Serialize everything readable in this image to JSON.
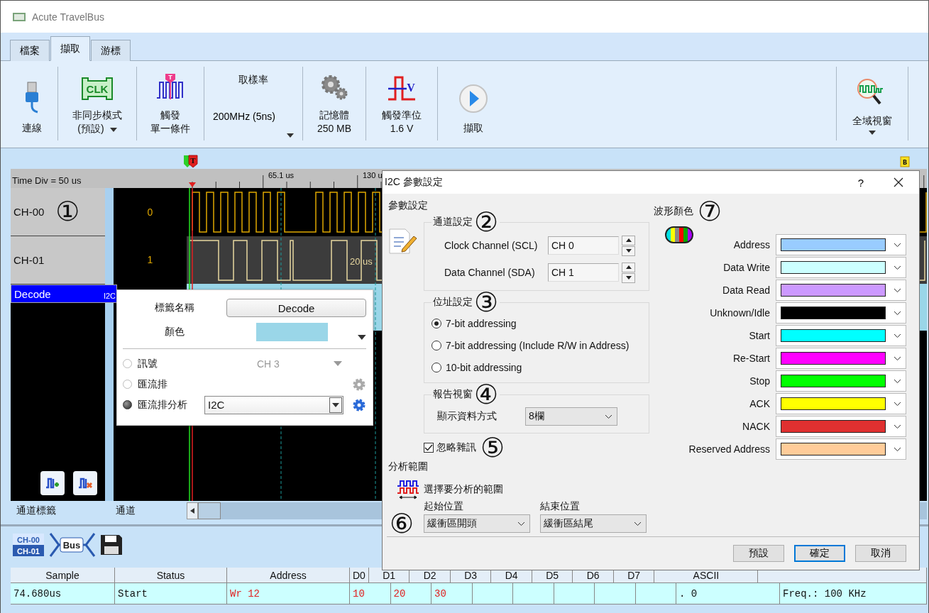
{
  "window": {
    "title": "Acute TravelBus"
  },
  "tabs": [
    {
      "label": "檔案",
      "selected": false
    },
    {
      "label": "擷取",
      "selected": true
    },
    {
      "label": "游標",
      "selected": false
    }
  ],
  "ribbon": [
    {
      "kind": "usb",
      "label": "連線"
    },
    {
      "kind": "clk",
      "icon_text": "CLK",
      "label": "非同步模式",
      "sublabel": "(預設)",
      "dropdown": true
    },
    {
      "kind": "trigger",
      "icon_text": "T",
      "label": "觸發",
      "sublabel": "單一條件"
    },
    {
      "kind": "rate",
      "label": "取樣率",
      "sublabel": "200MHz (5ns)",
      "dropdown": true
    },
    {
      "kind": "gears",
      "label": "記憶體",
      "sublabel": "250 MB"
    },
    {
      "kind": "level",
      "icon_text": "V",
      "label": "觸發準位",
      "sublabel": "1.6 V"
    },
    {
      "kind": "play",
      "label": "擷取"
    },
    {
      "kind": "zoom",
      "label": "全域視窗",
      "dropdown": true
    }
  ],
  "waveform": {
    "trigger_flag": "T",
    "cursor_flag": "B",
    "time_div": "Time Div = 50 us",
    "ruler": [
      "65.1 us",
      "130 u"
    ],
    "channels": [
      {
        "kind": "clock",
        "label": "CH-00",
        "marker": "①",
        "number": "0",
        "selected": false
      },
      {
        "kind": "data",
        "label": "CH-01",
        "number": "1",
        "annotation": "20 us",
        "selected": false
      },
      {
        "kind": "decode",
        "label": "Decode",
        "bus": "I2C",
        "selected": true
      }
    ],
    "footer": [
      "通道標籤",
      "通道"
    ]
  },
  "label_popup": {
    "name_label": "標籤名稱",
    "name": "Decode",
    "color_label": "顏色",
    "color": "#9ad6e8",
    "sources": [
      {
        "kind": "signal",
        "label": "訊號",
        "value": "CH 3",
        "selected": false
      },
      {
        "kind": "bus",
        "label": "匯流排",
        "selected": false
      },
      {
        "kind": "analyzer",
        "label": "匯流排分析",
        "value": "I2C",
        "selected": true
      }
    ]
  },
  "dialog": {
    "title": "I2C 參數設定",
    "help": "?",
    "section": "參數設定",
    "channel_group": {
      "title": "通道設定",
      "marker": "②",
      "fields": [
        {
          "label": "Clock Channel (SCL)",
          "value": "CH 0"
        },
        {
          "label": "Data Channel (SDA)",
          "value": "CH 1"
        }
      ]
    },
    "address_group": {
      "title": "位址設定",
      "marker": "③",
      "options": [
        {
          "label": "7-bit addressing",
          "selected": true
        },
        {
          "label": "7-bit addressing (Include R/W in Address)",
          "selected": false
        },
        {
          "label": "10-bit addressing",
          "selected": false
        }
      ]
    },
    "report_group": {
      "title": "報告視窗",
      "marker": "④",
      "field_label": "顯示資料方式",
      "value": "8欄"
    },
    "ignore_noise": {
      "label": "忽略雜訊",
      "checked": true,
      "marker": "⑤"
    },
    "range": {
      "title": "分析範圍",
      "hint": "選擇要分析的範圍",
      "marker": "⑥",
      "start_label": "起始位置",
      "start": "緩衝區開頭",
      "end_label": "結束位置",
      "end": "緩衝區結尾"
    },
    "colors": {
      "title": "波形顏色",
      "marker": "⑦",
      "items": [
        {
          "label": "Address",
          "color": "#99ccff"
        },
        {
          "label": "Data Write",
          "color": "#ccffff"
        },
        {
          "label": "Data Read",
          "color": "#cc99ff"
        },
        {
          "label": "Unknown/Idle",
          "color": "#000000"
        },
        {
          "label": "Start",
          "color": "#00ffff"
        },
        {
          "label": "Re-Start",
          "color": "#ff00ff"
        },
        {
          "label": "Stop",
          "color": "#00ff00"
        },
        {
          "label": "ACK",
          "color": "#ffff00"
        },
        {
          "label": "NACK",
          "color": "#e03030"
        },
        {
          "label": "Reserved Address",
          "color": "#ffcc99"
        }
      ]
    },
    "buttons": [
      {
        "label": "預設",
        "default": false
      },
      {
        "label": "確定",
        "default": true
      },
      {
        "label": "取消",
        "default": false
      }
    ]
  },
  "toolbar": {
    "channel_badge": [
      "CH-00",
      "CH-01"
    ],
    "bus_badge": "Bus"
  },
  "table": {
    "columns": [
      "Sample",
      "Status",
      "Address",
      "D0",
      "D1",
      "D2",
      "D3",
      "D4",
      "D5",
      "D6",
      "D7",
      "ASCII"
    ],
    "rows": [
      {
        "sample": "74.680us",
        "status": "Start",
        "address": "Wr 12",
        "data": [
          "10",
          "20",
          "30"
        ],
        "ascii": ". 0",
        "note": "Freq.: 100 KHz"
      }
    ]
  }
}
